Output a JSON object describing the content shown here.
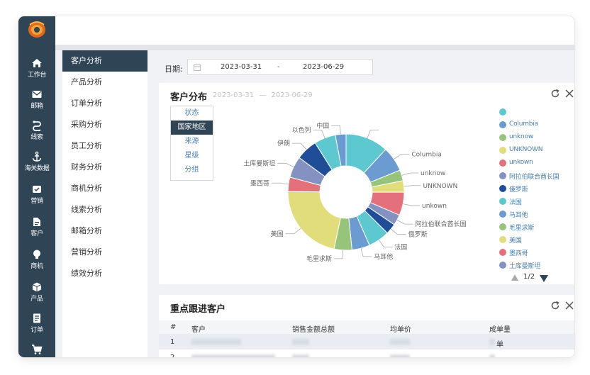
{
  "sidebar": {
    "items": [
      {
        "label": "工作台",
        "icon": "home-icon"
      },
      {
        "label": "邮箱",
        "icon": "mail-icon"
      },
      {
        "label": "线索",
        "icon": "leads-icon"
      },
      {
        "label": "海关数据",
        "icon": "anchor-icon"
      },
      {
        "label": "营销",
        "icon": "marketing-icon"
      },
      {
        "label": "客户",
        "icon": "customer-icon"
      },
      {
        "label": "商机",
        "icon": "lightbulb-icon"
      },
      {
        "label": "产品",
        "icon": "box-icon"
      },
      {
        "label": "订单",
        "icon": "order-icon"
      },
      {
        "label": "",
        "icon": "cart-icon"
      }
    ]
  },
  "submenu": {
    "items": [
      "客户分析",
      "产品分析",
      "订单分析",
      "采购分析",
      "员工分析",
      "财务分析",
      "商机分析",
      "线索分析",
      "邮箱分析",
      "营销分析",
      "绩效分析"
    ],
    "active_index": 0
  },
  "date_filter": {
    "label": "日期:",
    "start": "2023-03-31",
    "separator": "-",
    "end": "2023-06-29"
  },
  "distribution_card": {
    "title": "客户分布",
    "range_start": "2023-03-31",
    "range_separator": "—",
    "range_end": "2023-06-29",
    "dimensions": [
      "状态",
      "国家地区",
      "来源",
      "星级",
      "分组"
    ],
    "active_dimension": 1,
    "pager": "1/2"
  },
  "chart_data": {
    "type": "pie",
    "donut": true,
    "slices": [
      {
        "label": "",
        "value": 12,
        "color": "#5dc8d0"
      },
      {
        "label": "Columbia",
        "value": 7,
        "color": "#6b9bd0"
      },
      {
        "label": "unknow",
        "value": 3,
        "color": "#96c47a"
      },
      {
        "label": "UNKNOWN",
        "value": 3.2,
        "color": "#e0dd7a"
      },
      {
        "label": "unkown",
        "value": 6.5,
        "color": "#e4707c"
      },
      {
        "label": "阿拉伯联合酋长国",
        "value": 3,
        "color": "#8492c2"
      },
      {
        "label": "俄罗斯",
        "value": 3,
        "color": "#1f4d97"
      },
      {
        "label": "法国",
        "value": 6,
        "color": "#5dc8d0"
      },
      {
        "label": "马耳他",
        "value": 5,
        "color": "#6b9bd0"
      },
      {
        "label": "毛里求斯",
        "value": 5,
        "color": "#96c47a"
      },
      {
        "label": "美国",
        "value": 22,
        "color": "#e0dd7a"
      },
      {
        "label": "墨西哥",
        "value": 4,
        "color": "#e4707c"
      },
      {
        "label": "土库曼斯坦",
        "value": 6,
        "color": "#8492c2"
      },
      {
        "label": "伊朗",
        "value": 6,
        "color": "#1f4d97"
      },
      {
        "label": "以色列",
        "value": 6,
        "color": "#5dc8d0"
      },
      {
        "label": "中国",
        "value": 3,
        "color": "#6b9bd0"
      }
    ],
    "legend_page": 1,
    "legend_pages": 2
  },
  "legend": [
    {
      "label": "",
      "color": "#5dc8d0"
    },
    {
      "label": "Columbia",
      "color": "#6b9bd0"
    },
    {
      "label": "unknow",
      "color": "#96c47a"
    },
    {
      "label": "UNKNOWN",
      "color": "#e0dd7a"
    },
    {
      "label": "unkown",
      "color": "#e4707c"
    },
    {
      "label": "阿拉伯联合酋长国",
      "color": "#8492c2"
    },
    {
      "label": "俄罗斯",
      "color": "#1f4d97"
    },
    {
      "label": "法国",
      "color": "#5dc8d0"
    },
    {
      "label": "马耳他",
      "color": "#6b9bd0"
    },
    {
      "label": "毛里求斯",
      "color": "#96c47a"
    },
    {
      "label": "美国",
      "color": "#e0dd7a"
    },
    {
      "label": "墨西哥",
      "color": "#e4707c"
    },
    {
      "label": "土库曼斯坦",
      "color": "#8492c2"
    }
  ],
  "followup_card": {
    "title": "重点跟进客户",
    "columns": [
      "#",
      "客户",
      "销售金额总额",
      "均单价",
      "成单量"
    ],
    "rows": [
      {
        "index": "1",
        "unit": "单"
      },
      {
        "index": "2",
        "unit": ""
      }
    ]
  }
}
